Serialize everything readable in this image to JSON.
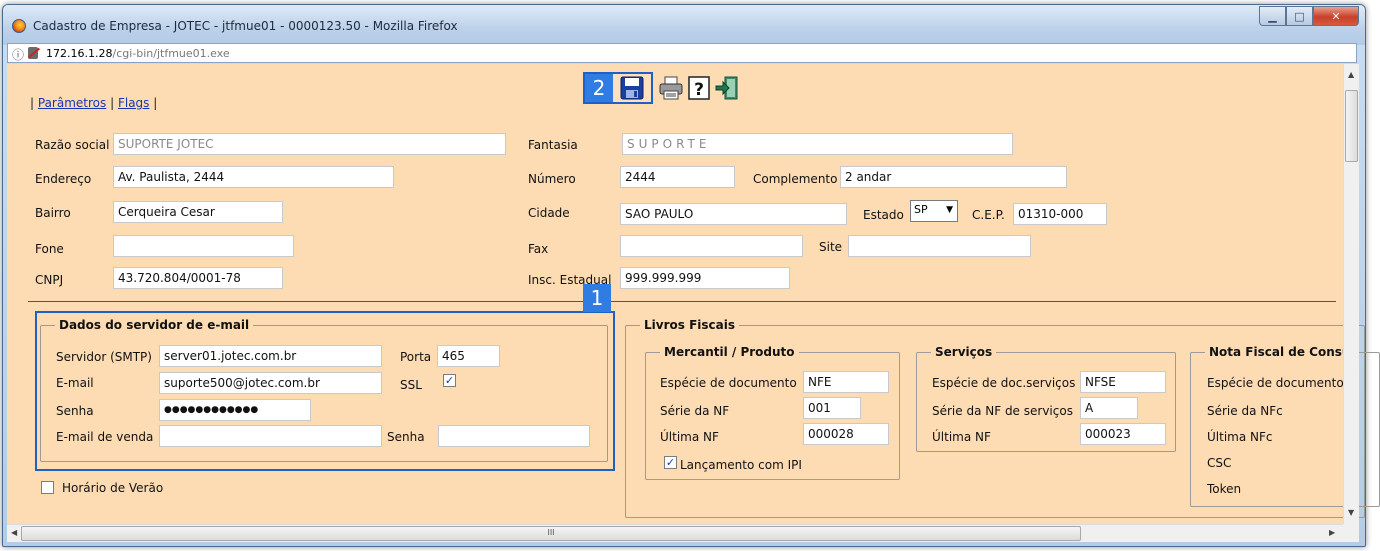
{
  "window": {
    "title": "Cadastro de Empresa - JOTEC - jtfmue01 - 0000123.50 - Mozilla Firefox",
    "minimize_glyph": "▁",
    "maximize_glyph": "□",
    "close_glyph": "✕"
  },
  "urlbar": {
    "host": "172.16.1.28",
    "path": "/cgi-bin/jtfmue01.exe"
  },
  "nav": {
    "separator_left": "|",
    "separator_mid": "|",
    "separator_right": "|",
    "parametros": "Parâmetros",
    "flags": "Flags"
  },
  "toolbar": {
    "icons": [
      "save-icon",
      "print-icon",
      "help-icon",
      "exit-icon"
    ]
  },
  "badges": {
    "one": "1",
    "two": "2"
  },
  "empresa": {
    "razao_social_label": "Razão social",
    "razao_social": "SUPORTE JOTEC",
    "fantasia_label": "Fantasia",
    "fantasia": "SUPORTE",
    "endereco_label": "Endereço",
    "endereco": "Av. Paulista, 2444",
    "numero_label": "Número",
    "numero": "2444",
    "complemento_label": "Complemento",
    "complemento": "2 andar",
    "bairro_label": "Bairro",
    "bairro": "Cerqueira Cesar",
    "cidade_label": "Cidade",
    "cidade": "SAO PAULO",
    "estado_label": "Estado",
    "estado": "SP",
    "cep_label": "C.E.P.",
    "cep": "01310-000",
    "fone_label": "Fone",
    "fone": "",
    "fax_label": "Fax",
    "fax": "",
    "site_label": "Site",
    "site": "",
    "cnpj_label": "CNPJ",
    "cnpj": "43.720.804/0001-78",
    "insc_estadual_label": "Insc. Estadual",
    "insc_estadual": "999.999.999"
  },
  "email": {
    "legend": "Dados do servidor de e-mail",
    "servidor_label": "Servidor (SMTP)",
    "servidor": "server01.jotec.com.br",
    "porta_label": "Porta",
    "porta": "465",
    "email_label": "E-mail",
    "email": "suporte500@jotec.com.br",
    "ssl_label": "SSL",
    "ssl_checked": true,
    "senha_label": "Senha",
    "senha": "●●●●●●●●●●●●",
    "email_venda_label": "E-mail de venda",
    "email_venda": "",
    "senha_venda_label": "Senha",
    "senha_venda": ""
  },
  "horario_verao_label": "Horário de Verão",
  "horario_verao_checked": false,
  "livros": {
    "legend": "Livros Fiscais",
    "mercantil": {
      "legend": "Mercantil / Produto",
      "especie_label": "Espécie de documento",
      "especie": "NFE",
      "serie_label": "Série da NF",
      "serie": "001",
      "ultima_label": "Última NF",
      "ultima": "000028",
      "lancamento_label": "Lançamento com IPI",
      "lancamento_checked": true
    },
    "servicos": {
      "legend": "Serviços",
      "especie_label": "Espécie de doc.serviços",
      "especie": "NFSE",
      "serie_label": "Série da NF de serviços",
      "serie": "A",
      "ultima_label": "Última NF",
      "ultima": "000023"
    },
    "nfc": {
      "legend": "Nota Fiscal de Consu",
      "especie_label": "Espécie de documento",
      "serie_label": "Série da NFc",
      "ultima_label": "Última NFc",
      "csc_label": "CSC",
      "token_label": "Token"
    }
  },
  "scroll": {
    "up": "▲",
    "down": "▼",
    "left": "◀",
    "right": "▶",
    "grip": "III"
  }
}
